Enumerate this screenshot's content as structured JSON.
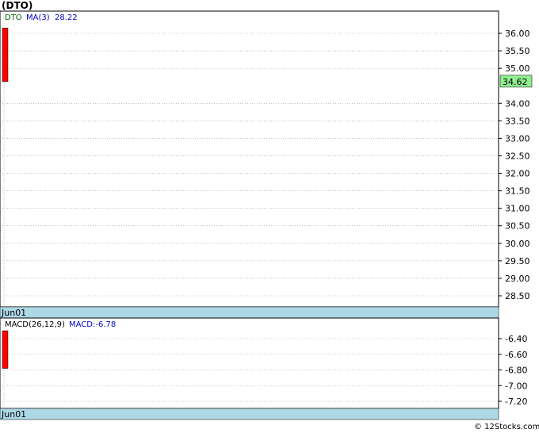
{
  "chart_data": [
    {
      "type": "candlestick",
      "title": "(DTO)",
      "legend": {
        "symbol": "DTO",
        "indicator": "MA(3)",
        "value": "28.22"
      },
      "categories": [
        "Jun01"
      ],
      "ohlc": [
        {
          "date": "Jun01",
          "open": 36.15,
          "high": 36.15,
          "low": 34.62,
          "close": 34.62
        }
      ],
      "last_price": "34.62",
      "y_ticks": [
        "36.00",
        "35.50",
        "35.00",
        "34.00",
        "33.50",
        "33.00",
        "32.50",
        "32.00",
        "31.50",
        "31.00",
        "30.50",
        "30.00",
        "29.50",
        "29.00",
        "28.50"
      ],
      "y_tick_values": [
        36.0,
        35.5,
        35.0,
        34.0,
        33.5,
        33.0,
        32.5,
        32.0,
        31.5,
        31.0,
        30.5,
        30.0,
        29.5,
        29.0,
        28.5
      ],
      "ylim": [
        28.2,
        36.6
      ],
      "grid": true,
      "x_label": "Jun01"
    },
    {
      "type": "bar",
      "legend": {
        "indicator": "MACD(26,12,9)",
        "value_label": "MACD:-6.78"
      },
      "categories": [
        "Jun01"
      ],
      "bars": [
        {
          "date": "Jun01",
          "from": -6.3,
          "to": -6.78
        }
      ],
      "y_ticks": [
        "-6.40",
        "-6.60",
        "-6.80",
        "-7.00",
        "-7.20"
      ],
      "y_tick_values": [
        -6.4,
        -6.6,
        -6.8,
        -7.0,
        -7.2
      ],
      "ylim": [
        -7.3,
        -6.25
      ],
      "grid": true,
      "x_label": "Jun01"
    }
  ],
  "footer": "© 12Stocks.com",
  "colors": {
    "down": "#ff0000",
    "date_bar": "#add8e6",
    "last_price_bg": "#90ee90",
    "grid": "#999999"
  }
}
